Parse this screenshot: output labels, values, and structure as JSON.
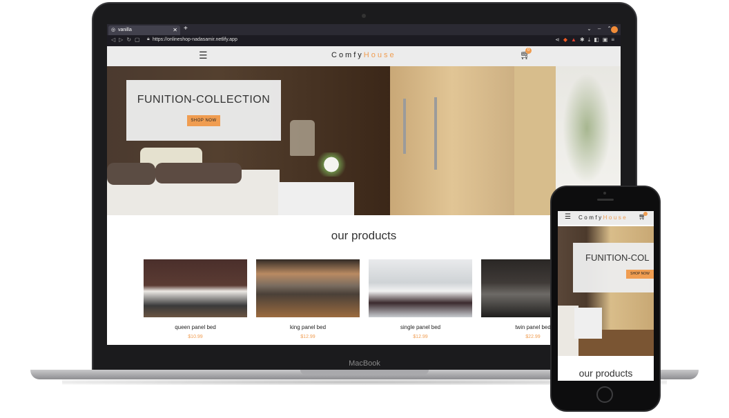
{
  "laptop": {
    "label": "MacBook"
  },
  "browser": {
    "tab_title": "vanilla",
    "url": "https://onlineshop-nadasamir.netlify.app"
  },
  "site": {
    "logo_primary": "Comfy",
    "logo_accent": "House",
    "cart_count": "0",
    "hero_title": "FUNITION-COLLECTION",
    "hero_button": "SHOP NOW",
    "products_heading": "our products",
    "products": [
      {
        "name": "queen panel bed",
        "price": "$10.99"
      },
      {
        "name": "king panel bed",
        "price": "$12.99"
      },
      {
        "name": "single panel bed",
        "price": "$12.99"
      },
      {
        "name": "twin panel bed",
        "price": "$22.99"
      }
    ]
  },
  "phone": {
    "logo_primary": "Comfy",
    "logo_accent": "House",
    "hero_title": "FUNITION-COL",
    "hero_button": "SHOP NOW",
    "products_heading": "our products"
  },
  "colors": {
    "accent": "#f09d51",
    "nav_bg": "#ececec",
    "browser_bg": "#2b2a33"
  },
  "icons": [
    "globe-icon",
    "close-icon",
    "plus-icon",
    "back-icon",
    "forward-icon",
    "reload-icon",
    "bookmark-icon",
    "lock-icon",
    "share-icon",
    "brave-shield-icon",
    "extension-icon",
    "download-icon",
    "sidebar-icon",
    "menu-icon",
    "hamburger-icon",
    "cart-icon"
  ]
}
